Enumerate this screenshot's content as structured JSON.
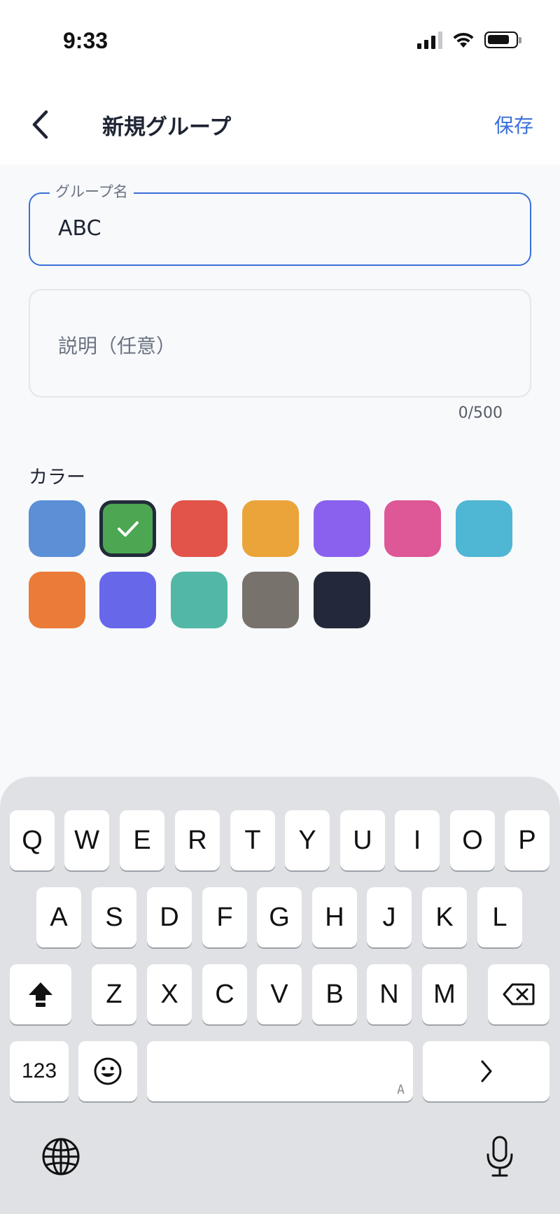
{
  "status_bar": {
    "time": "9:33"
  },
  "header": {
    "title": "新規グループ",
    "save_label": "保存"
  },
  "form": {
    "name_label": "グループ名",
    "name_value": "ABC",
    "description_placeholder": "説明（任意）",
    "char_count": "0/500",
    "color_label": "カラー"
  },
  "colors": [
    {
      "name": "blue",
      "hex": "#5b8fd6",
      "selected": false
    },
    {
      "name": "green",
      "hex": "#4ca652",
      "selected": true
    },
    {
      "name": "red",
      "hex": "#e2534a",
      "selected": false
    },
    {
      "name": "amber",
      "hex": "#eba43a",
      "selected": false
    },
    {
      "name": "purple",
      "hex": "#8a60ef",
      "selected": false
    },
    {
      "name": "pink",
      "hex": "#de5796",
      "selected": false
    },
    {
      "name": "cyan",
      "hex": "#4fb6d4",
      "selected": false
    },
    {
      "name": "orange",
      "hex": "#ea7b38",
      "selected": false
    },
    {
      "name": "indigo",
      "hex": "#6767ea",
      "selected": false
    },
    {
      "name": "teal",
      "hex": "#52b7a6",
      "selected": false
    },
    {
      "name": "gray",
      "hex": "#77726c",
      "selected": false
    },
    {
      "name": "navy",
      "hex": "#23293a",
      "selected": false
    }
  ],
  "keyboard": {
    "row1": [
      "Q",
      "W",
      "E",
      "R",
      "T",
      "Y",
      "U",
      "I",
      "O",
      "P"
    ],
    "row2": [
      "A",
      "S",
      "D",
      "F",
      "G",
      "H",
      "J",
      "K",
      "L"
    ],
    "row3": [
      "Z",
      "X",
      "C",
      "V",
      "B",
      "N",
      "M"
    ],
    "numbers_label": "123",
    "space_hint": "A",
    "icons": {
      "shift": "shift-icon",
      "delete": "delete-icon",
      "emoji": "emoji-icon",
      "next": "chevron-right-icon",
      "globe": "globe-icon",
      "mic": "microphone-icon"
    }
  }
}
